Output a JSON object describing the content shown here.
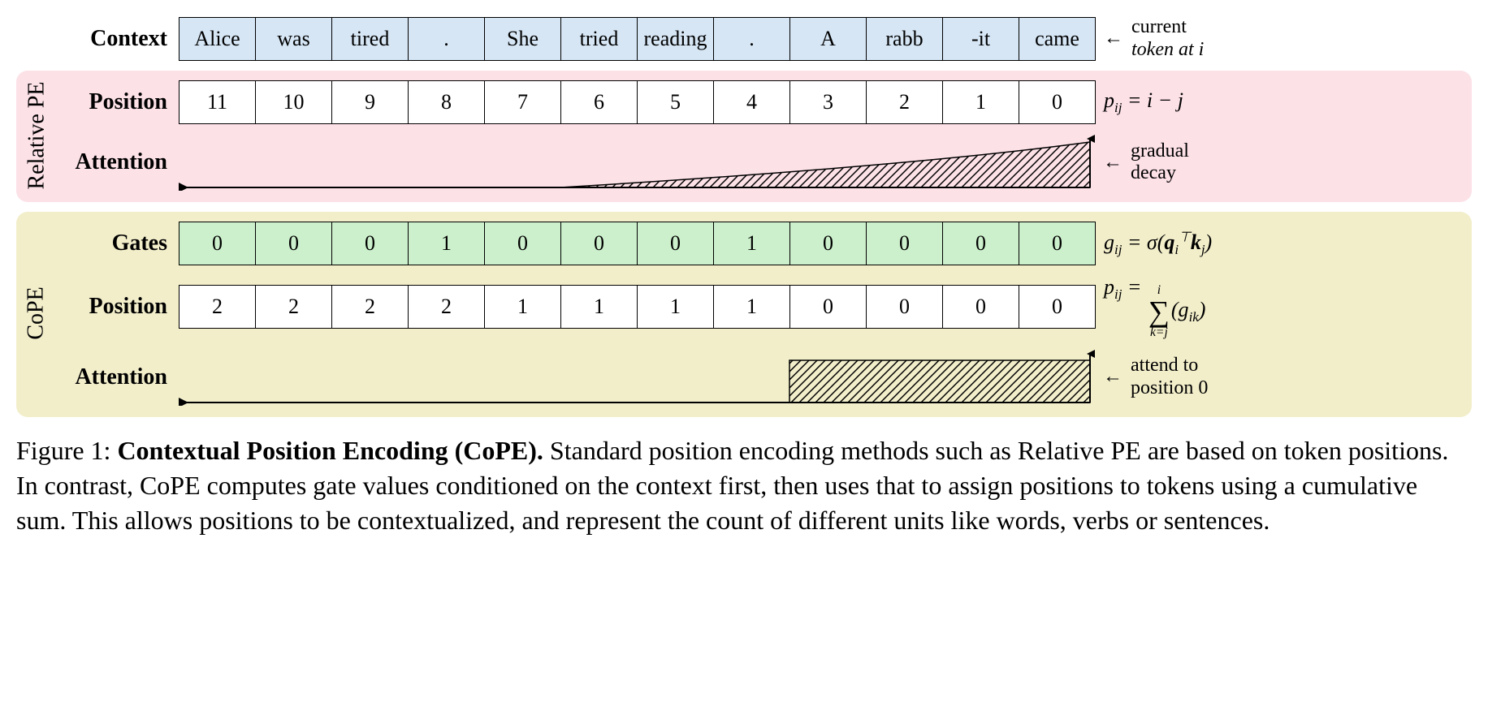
{
  "context": {
    "label": "Context",
    "tokens": [
      "Alice",
      "was",
      "tired",
      ".",
      "She",
      "tried",
      "reading",
      ".",
      "A",
      "rabb",
      "-it",
      "came"
    ],
    "annot_line1": "current",
    "annot_line2": "token at i"
  },
  "relpe": {
    "side_label": "Relative PE",
    "position_label": "Position",
    "positions": [
      "11",
      "10",
      "9",
      "8",
      "7",
      "6",
      "5",
      "4",
      "3",
      "2",
      "1",
      "0"
    ],
    "pos_formula_html": "p<sub>ij</sub> = i − j",
    "attention_label": "Attention",
    "attention_annot_line1": "gradual",
    "attention_annot_line2": "decay"
  },
  "cope": {
    "side_label": "CoPE",
    "gates_label": "Gates",
    "gates": [
      "0",
      "0",
      "0",
      "1",
      "0",
      "0",
      "0",
      "1",
      "0",
      "0",
      "0",
      "0"
    ],
    "gates_formula_html": "g<sub>ij</sub> = σ(<b>q</b><sub>i</sub><sup>⊤</sup><b>k</b><sub>j</sub>)",
    "position_label": "Position",
    "positions": [
      "2",
      "2",
      "2",
      "2",
      "1",
      "1",
      "1",
      "1",
      "0",
      "0",
      "0",
      "0"
    ],
    "pos_formula_lhs_html": "p<sub>ij</sub> = ",
    "pos_formula_upper": "i",
    "pos_formula_lower": "k=j",
    "pos_formula_body_html": "(g<sub>ik</sub>)",
    "attention_label": "Attention",
    "attention_annot_line1": "attend to",
    "attention_annot_line2": "position 0"
  },
  "caption": {
    "prefix": "Figure 1: ",
    "title": "Contextual Position Encoding (CoPE).",
    "body": " Standard position encoding methods such as Relative PE are based on token positions. In contrast, CoPE computes gate values conditioned on the context first, then uses that to assign positions to tokens using a cumulative sum. This allows positions to be contextualized, and represent the count of different units like words, verbs or sentences."
  }
}
